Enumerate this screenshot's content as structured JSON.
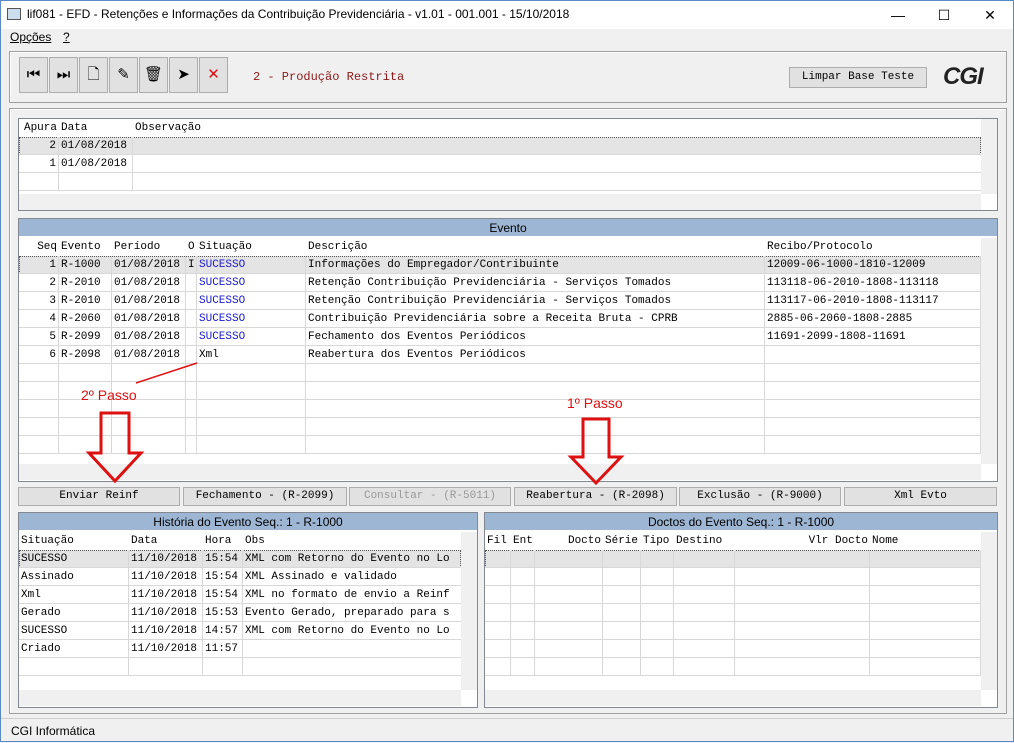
{
  "window": {
    "title": "lif081 - EFD - Retenções e Informações da Contribuição Previdenciária - v1.01 - 001.001 - 15/10/2018",
    "minimize": "—",
    "maximize": "☐",
    "close": "✕"
  },
  "menu": {
    "items": [
      "Opções",
      "?"
    ]
  },
  "toolbar": {
    "buttons": [
      {
        "icon": "first-record-icon",
        "glyph": "⏮"
      },
      {
        "icon": "last-record-icon",
        "glyph": "⏭"
      },
      {
        "icon": "new-document-icon",
        "glyph": "🗋"
      },
      {
        "icon": "edit-pencil-icon",
        "glyph": "✎"
      },
      {
        "icon": "trash-icon",
        "glyph": "🗑"
      },
      {
        "icon": "send-icon",
        "glyph": "➤"
      },
      {
        "icon": "cancel-x-icon",
        "glyph": "✕"
      }
    ],
    "environment": "2 - Produção Restrita",
    "clear_button": "Limpar Base Teste",
    "logo": "CGI"
  },
  "apuracao": {
    "columns": [
      "Apura",
      "Data",
      "Observação"
    ],
    "rows": [
      [
        "2",
        "01/08/2018",
        ""
      ],
      [
        "1",
        "01/08/2018",
        ""
      ]
    ]
  },
  "evento": {
    "title": "Evento",
    "columns": [
      "Seq",
      "Evento",
      "Período",
      "O",
      "Situação",
      "Descrição",
      "Recibo/Protocolo"
    ],
    "rows": [
      [
        "1",
        "R-1000",
        "01/08/2018",
        "I",
        "SUCESSO",
        "Informações do Empregador/Contribuinte",
        "12009-06-1000-1810-12009"
      ],
      [
        "2",
        "R-2010",
        "01/08/2018",
        "",
        "SUCESSO",
        "Retenção Contribuição Previdenciária - Serviços Tomados",
        "113118-06-2010-1808-113118"
      ],
      [
        "3",
        "R-2010",
        "01/08/2018",
        "",
        "SUCESSO",
        "Retenção Contribuição Previdenciária - Serviços Tomados",
        "113117-06-2010-1808-113117"
      ],
      [
        "4",
        "R-2060",
        "01/08/2018",
        "",
        "SUCESSO",
        "Contribuição Previdenciária sobre a Receita Bruta - CPRB",
        "2885-06-2060-1808-2885"
      ],
      [
        "5",
        "R-2099",
        "01/08/2018",
        "",
        "SUCESSO",
        "Fechamento dos Eventos Periódicos",
        "11691-2099-1808-11691"
      ],
      [
        "6",
        "R-2098",
        "01/08/2018",
        "",
        "Xml",
        "Reabertura dos Eventos Periódicos",
        ""
      ]
    ]
  },
  "actions": [
    {
      "label": "Enviar Reinf",
      "enabled": true
    },
    {
      "label": "Fechamento - (R-2099)",
      "enabled": true
    },
    {
      "label": "Consultar - (R-5011)",
      "enabled": false
    },
    {
      "label": "Reabertura - (R-2098)",
      "enabled": true
    },
    {
      "label": "Exclusão - (R-9000)",
      "enabled": true
    },
    {
      "label": "Xml Evto",
      "enabled": true
    }
  ],
  "historia": {
    "title": "História do Evento Seq.: 1 - R-1000",
    "columns": [
      "Situação",
      "Data",
      "Hora",
      "Obs"
    ],
    "rows": [
      [
        "SUCESSO",
        "11/10/2018",
        "15:54",
        "XML com Retorno do Evento no Lo"
      ],
      [
        "Assinado",
        "11/10/2018",
        "15:54",
        "XML Assinado e validado"
      ],
      [
        "Xml",
        "11/10/2018",
        "15:54",
        "XML no formato de envio a Reinf"
      ],
      [
        "Gerado",
        "11/10/2018",
        "15:53",
        "Evento Gerado, preparado para s"
      ],
      [
        "SUCESSO",
        "11/10/2018",
        "14:57",
        "XML com Retorno do Evento no Lo"
      ],
      [
        "Criado",
        "11/10/2018",
        "11:57",
        ""
      ]
    ]
  },
  "doctos": {
    "title": "Doctos do Evento Seq.: 1 - R-1000",
    "columns": [
      "Fil",
      "Ent",
      "Docto",
      "Série",
      "Tipo",
      "Destino",
      "Vlr Docto",
      "Nome"
    ]
  },
  "annotations": {
    "step2": "2º Passo",
    "step1": "1º Passo"
  },
  "status": {
    "text": "CGI Informática"
  },
  "colors": {
    "success": "#1a1acc",
    "annotation": "#d11111",
    "panel_header": "#9db6d3",
    "environment": "#8b1a1a"
  }
}
